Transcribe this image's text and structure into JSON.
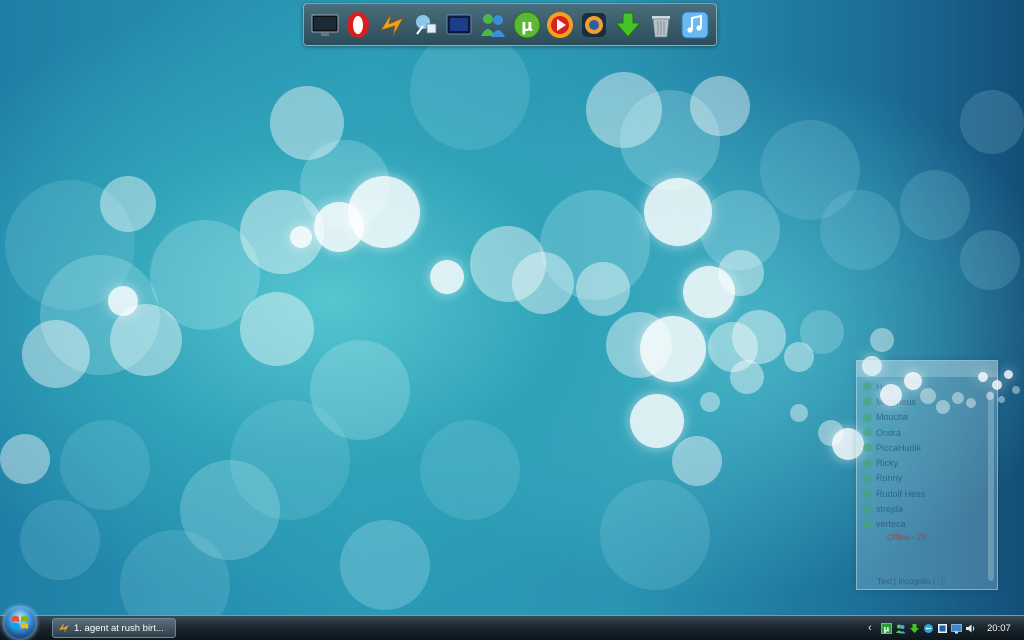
{
  "dock": {
    "icons": [
      "computer-icon",
      "opera-icon",
      "winamp-icon",
      "network-icon",
      "monitor-icon",
      "messenger-icon",
      "utorrent-icon",
      "media-player-icon",
      "music-player-icon",
      "download-icon",
      "recycle-bin-icon",
      "itunes-icon"
    ]
  },
  "contacts": {
    "names": [
      "Haly",
      "Morpheus",
      "Moucha",
      "Ondra",
      "PiccaHudik",
      "Ricky",
      "Ronny",
      "Rudolf Hess",
      "strejda",
      "verteca"
    ],
    "group_label": "Offline - 23",
    "footer": "Text | Incognito | ⓘ"
  },
  "taskbar": {
    "task_label": "1. agent at rush birt...",
    "clock": "20:07",
    "tray_icons": [
      "messenger-tray-icon",
      "utorrent-tray-icon",
      "download-tray-icon",
      "network-tray-icon",
      "security-tray-icon",
      "display-tray-icon",
      "volume-icon"
    ]
  }
}
